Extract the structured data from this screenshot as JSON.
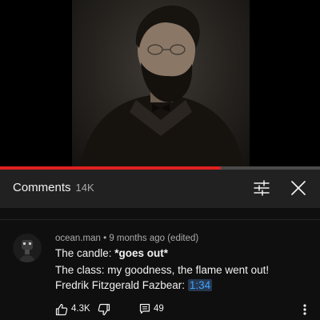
{
  "player": {
    "progress_fraction": 0.69,
    "progress_color": "#e02020"
  },
  "comments_panel": {
    "title": "Comments",
    "count": "14K",
    "icons": [
      "filter-icon",
      "close-icon"
    ]
  },
  "comment": {
    "author": "ocean.man",
    "separator": "•",
    "age": "9 months ago (edited)",
    "line1_prefix": "The candle: ",
    "line1_bold": "*goes out*",
    "line2": "The class: my goodness, the flame went out!",
    "line3_prefix": "Fredrik Fitzgerald Fazbear: ",
    "line3_timestamp": "1:34",
    "likes": "4.3K",
    "replies": "49",
    "action_icons": [
      "like-icon",
      "dislike-icon",
      "reply-icon",
      "more-vert-icon"
    ]
  },
  "colors": {
    "background": "#0f0f0f",
    "header_bg": "#212121",
    "link": "#3ea6ff",
    "secondary_text": "#aaaaaa"
  }
}
